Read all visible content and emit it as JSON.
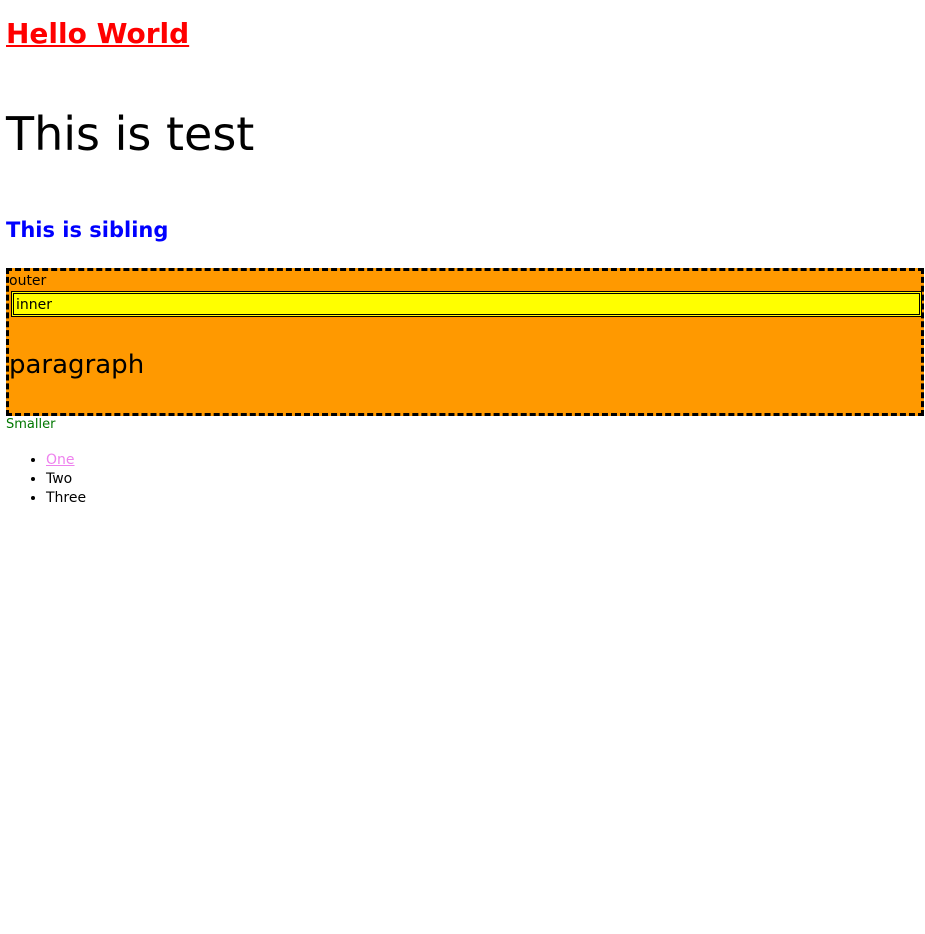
{
  "headings": {
    "hello": "Hello World",
    "test": "This is test",
    "sibling": "This is sibling"
  },
  "outer": {
    "label": "outer",
    "inner_label": "inner",
    "paragraph": "paragraph"
  },
  "smaller": "Smaller",
  "list": {
    "items": [
      {
        "label": "One",
        "is_link": true
      },
      {
        "label": "Two",
        "is_link": false
      },
      {
        "label": "Three",
        "is_link": false
      }
    ]
  },
  "colors": {
    "hello": "#ff0000",
    "sibling": "#0000ff",
    "outer_bg": "#ff9900",
    "inner_bg": "#ffff00",
    "smaller": "#007700",
    "link": "#ee82ee"
  }
}
